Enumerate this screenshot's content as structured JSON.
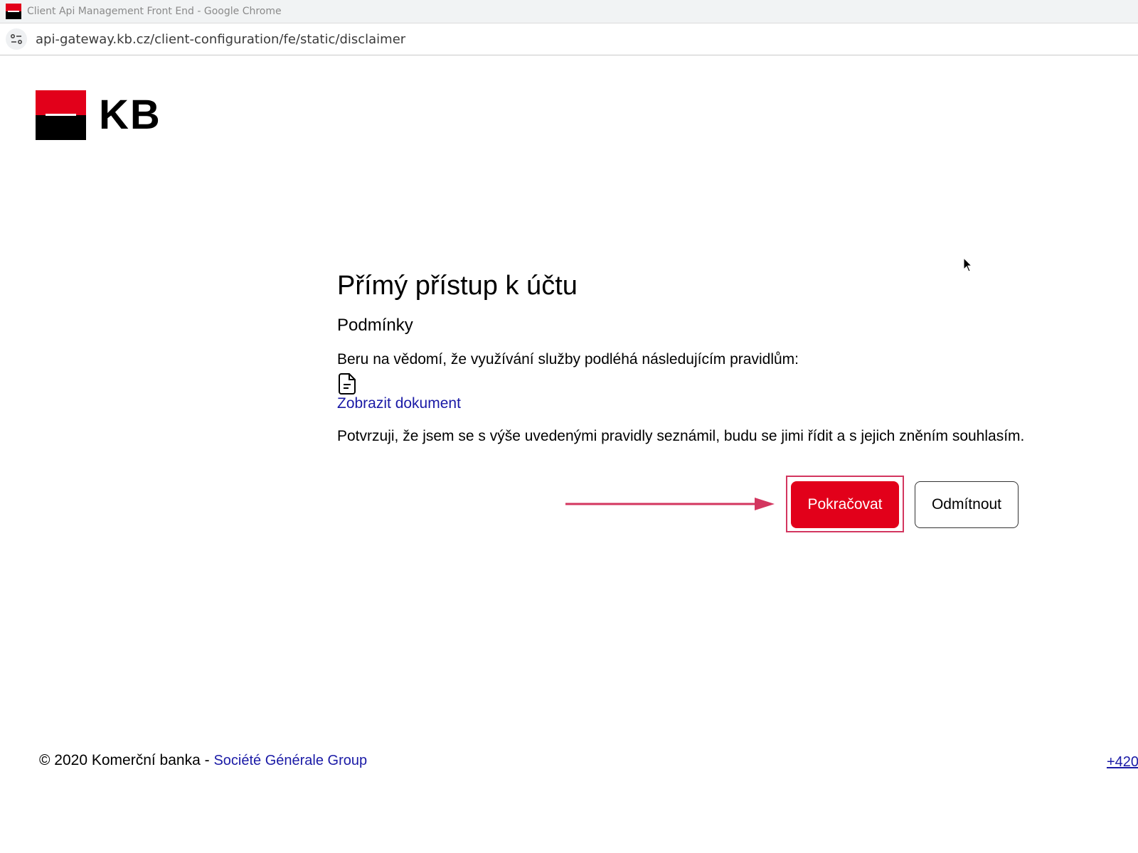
{
  "browser": {
    "window_title": "Client Api Management Front End - Google Chrome",
    "url": "api-gateway.kb.cz/client-configuration/fe/static/disclaimer",
    "favicon": "kb-favicon",
    "site_info_icon": "tune-icon"
  },
  "logo": {
    "text": "KB",
    "colors": {
      "red": "#e2001a",
      "black": "#000000"
    }
  },
  "main": {
    "title": "Přímý přístup k účtu",
    "subtitle": "Podmínky",
    "intro": "Beru na vědomí, že využívání služby podléhá následujícím pravidlům:",
    "document_icon": "document-icon",
    "document_link": "Zobrazit dokument",
    "confirmation": "Potvrzuji, že jsem se s výše uvedenými pravidly seznámil, budu se jimi řídit a s jejich zněním souhlasím."
  },
  "actions": {
    "continue_label": "Pokračovat",
    "decline_label": "Odmítnout",
    "accent": "#e2001a",
    "highlight": "#d3365f"
  },
  "footer": {
    "copyright": "© 2020 Komerční banka - ",
    "group_link": "Société Générale Group",
    "phone": "+420"
  }
}
